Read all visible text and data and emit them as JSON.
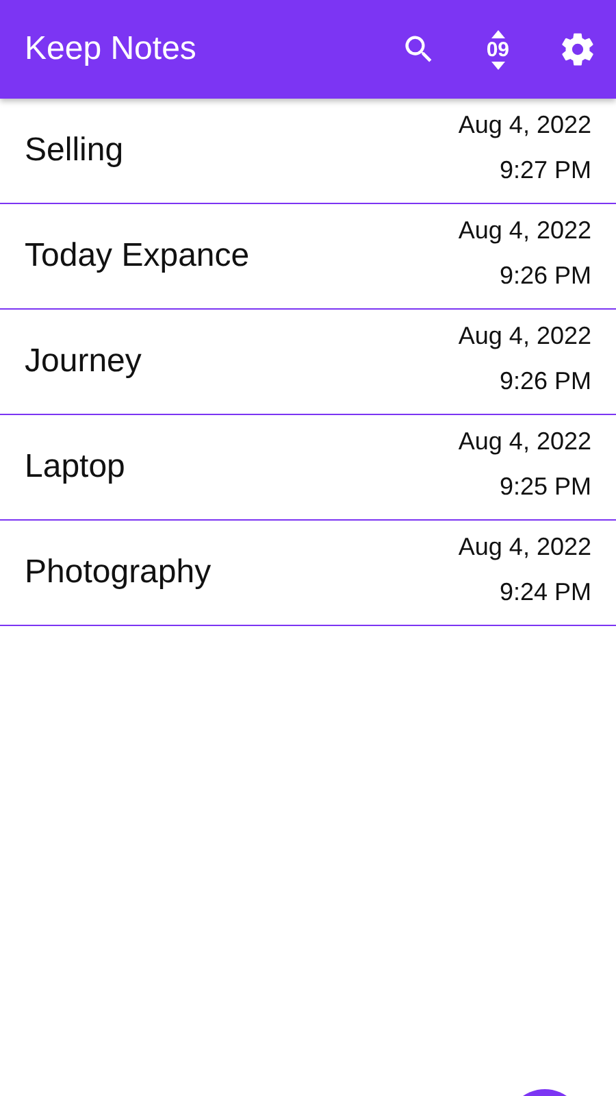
{
  "app_bar": {
    "title": "Keep Notes",
    "sort_icon_text": "09"
  },
  "notes": [
    {
      "title": "Selling",
      "date": "Aug 4, 2022",
      "time": "9:27 PM"
    },
    {
      "title": "Today Expance",
      "date": "Aug 4, 2022",
      "time": "9:26 PM"
    },
    {
      "title": "Journey",
      "date": "Aug 4, 2022",
      "time": "9:26 PM"
    },
    {
      "title": "Laptop",
      "date": "Aug 4, 2022",
      "time": "9:25 PM"
    },
    {
      "title": "Photography",
      "date": "Aug 4, 2022",
      "time": "9:24 PM"
    }
  ]
}
